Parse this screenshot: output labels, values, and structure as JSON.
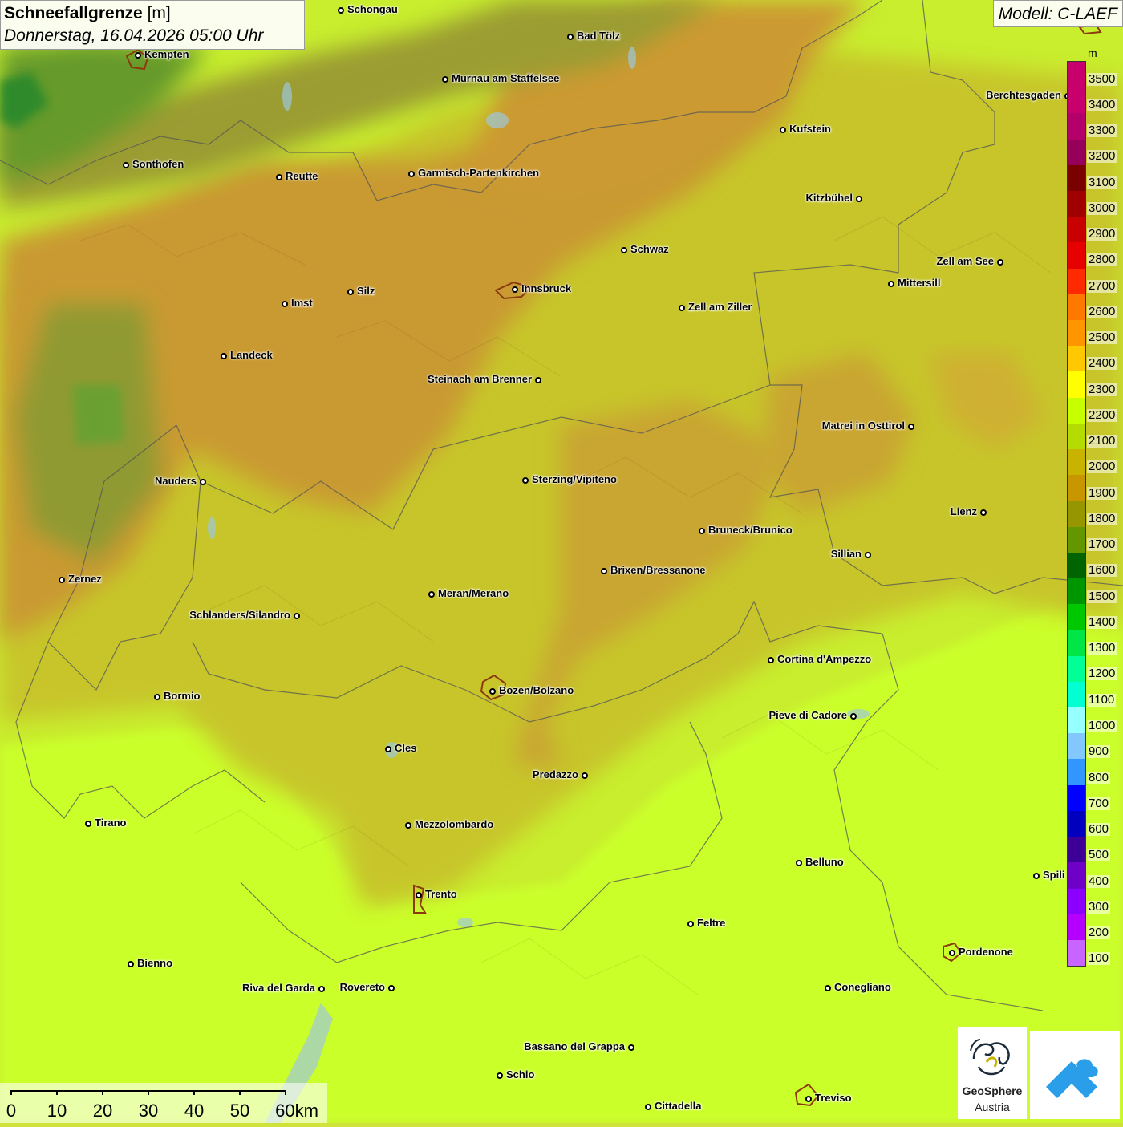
{
  "header": {
    "title_bold": "Schneefallgrenze",
    "title_unit": "[m]",
    "subtitle": "Donnerstag, 16.04.2026 05:00 Uhr",
    "model": "Modell: C-LAEF"
  },
  "legend": {
    "unit": "m",
    "levels": [
      {
        "value": "3500",
        "color": "#c8006e"
      },
      {
        "value": "3400",
        "color": "#c8006e"
      },
      {
        "value": "3300",
        "color": "#b4006a"
      },
      {
        "value": "3200",
        "color": "#96005a"
      },
      {
        "value": "3100",
        "color": "#7a0000"
      },
      {
        "value": "3000",
        "color": "#a00000"
      },
      {
        "value": "2900",
        "color": "#c80000"
      },
      {
        "value": "2800",
        "color": "#e60000"
      },
      {
        "value": "2700",
        "color": "#ff2a00"
      },
      {
        "value": "2600",
        "color": "#ff7800"
      },
      {
        "value": "2500",
        "color": "#ff9600"
      },
      {
        "value": "2400",
        "color": "#ffc800"
      },
      {
        "value": "2300",
        "color": "#ffff00"
      },
      {
        "value": "2200",
        "color": "#c8ff00"
      },
      {
        "value": "2100",
        "color": "#b4dc00"
      },
      {
        "value": "2000",
        "color": "#c8b400"
      },
      {
        "value": "1900",
        "color": "#c89600"
      },
      {
        "value": "1800",
        "color": "#969600"
      },
      {
        "value": "1700",
        "color": "#649600"
      },
      {
        "value": "1600",
        "color": "#006400"
      },
      {
        "value": "1500",
        "color": "#009600"
      },
      {
        "value": "1400",
        "color": "#00c800"
      },
      {
        "value": "1300",
        "color": "#00e646"
      },
      {
        "value": "1200",
        "color": "#00ff96"
      },
      {
        "value": "1100",
        "color": "#00ffd2"
      },
      {
        "value": "1000",
        "color": "#96ffff"
      },
      {
        "value": "900",
        "color": "#82c8ff"
      },
      {
        "value": "800",
        "color": "#3296ff"
      },
      {
        "value": "700",
        "color": "#0000ff"
      },
      {
        "value": "600",
        "color": "#0000be"
      },
      {
        "value": "500",
        "color": "#3c0096"
      },
      {
        "value": "400",
        "color": "#6e00c8"
      },
      {
        "value": "300",
        "color": "#8c00ff"
      },
      {
        "value": "200",
        "color": "#b400ff"
      },
      {
        "value": "100",
        "color": "#c864ff"
      }
    ]
  },
  "cities": [
    {
      "name": "Schongau"
    },
    {
      "name": "Kempten"
    },
    {
      "name": "Bad Tölz"
    },
    {
      "name": "Murnau am Staffelsee"
    },
    {
      "name": "Berchtesgaden"
    },
    {
      "name": "Kufstein"
    },
    {
      "name": "Sonthofen"
    },
    {
      "name": "Reutte"
    },
    {
      "name": "Garmisch-Partenkirchen"
    },
    {
      "name": "Kitzbühel"
    },
    {
      "name": "Schwaz"
    },
    {
      "name": "Zell am See"
    },
    {
      "name": "Mittersill"
    },
    {
      "name": "Imst"
    },
    {
      "name": "Silz"
    },
    {
      "name": "Innsbruck"
    },
    {
      "name": "Zell am Ziller"
    },
    {
      "name": "Landeck"
    },
    {
      "name": "Steinach am Brenner"
    },
    {
      "name": "Matrei in Osttirol"
    },
    {
      "name": "Nauders"
    },
    {
      "name": "Sterzing/Vipiteno"
    },
    {
      "name": "Lienz"
    },
    {
      "name": "Bruneck/Brunico"
    },
    {
      "name": "Sillian"
    },
    {
      "name": "Zernez"
    },
    {
      "name": "Brixen/Bressanone"
    },
    {
      "name": "Meran/Merano"
    },
    {
      "name": "Schlanders/Silandro"
    },
    {
      "name": "Cortina d'Ampezzo"
    },
    {
      "name": "Bozen/Bolzano"
    },
    {
      "name": "Bormio"
    },
    {
      "name": "Pieve di Cadore"
    },
    {
      "name": "Cles"
    },
    {
      "name": "Predazzo"
    },
    {
      "name": "Tirano"
    },
    {
      "name": "Mezzolombardo"
    },
    {
      "name": "Belluno"
    },
    {
      "name": "Spili"
    },
    {
      "name": "Trento"
    },
    {
      "name": "Feltre"
    },
    {
      "name": "Bienno"
    },
    {
      "name": "Pordenone"
    },
    {
      "name": "Riva del Garda"
    },
    {
      "name": "Rovereto"
    },
    {
      "name": "Conegliano"
    },
    {
      "name": "Bassano del Grappa"
    },
    {
      "name": "Schio"
    },
    {
      "name": "Treviso"
    },
    {
      "name": "Cittadella"
    }
  ],
  "scalebar": {
    "labels": [
      "0",
      "10",
      "20",
      "30",
      "40",
      "50",
      "60km"
    ]
  },
  "logos": {
    "geosphere_name": "GeoSphere",
    "geosphere_sub": "Austria"
  }
}
